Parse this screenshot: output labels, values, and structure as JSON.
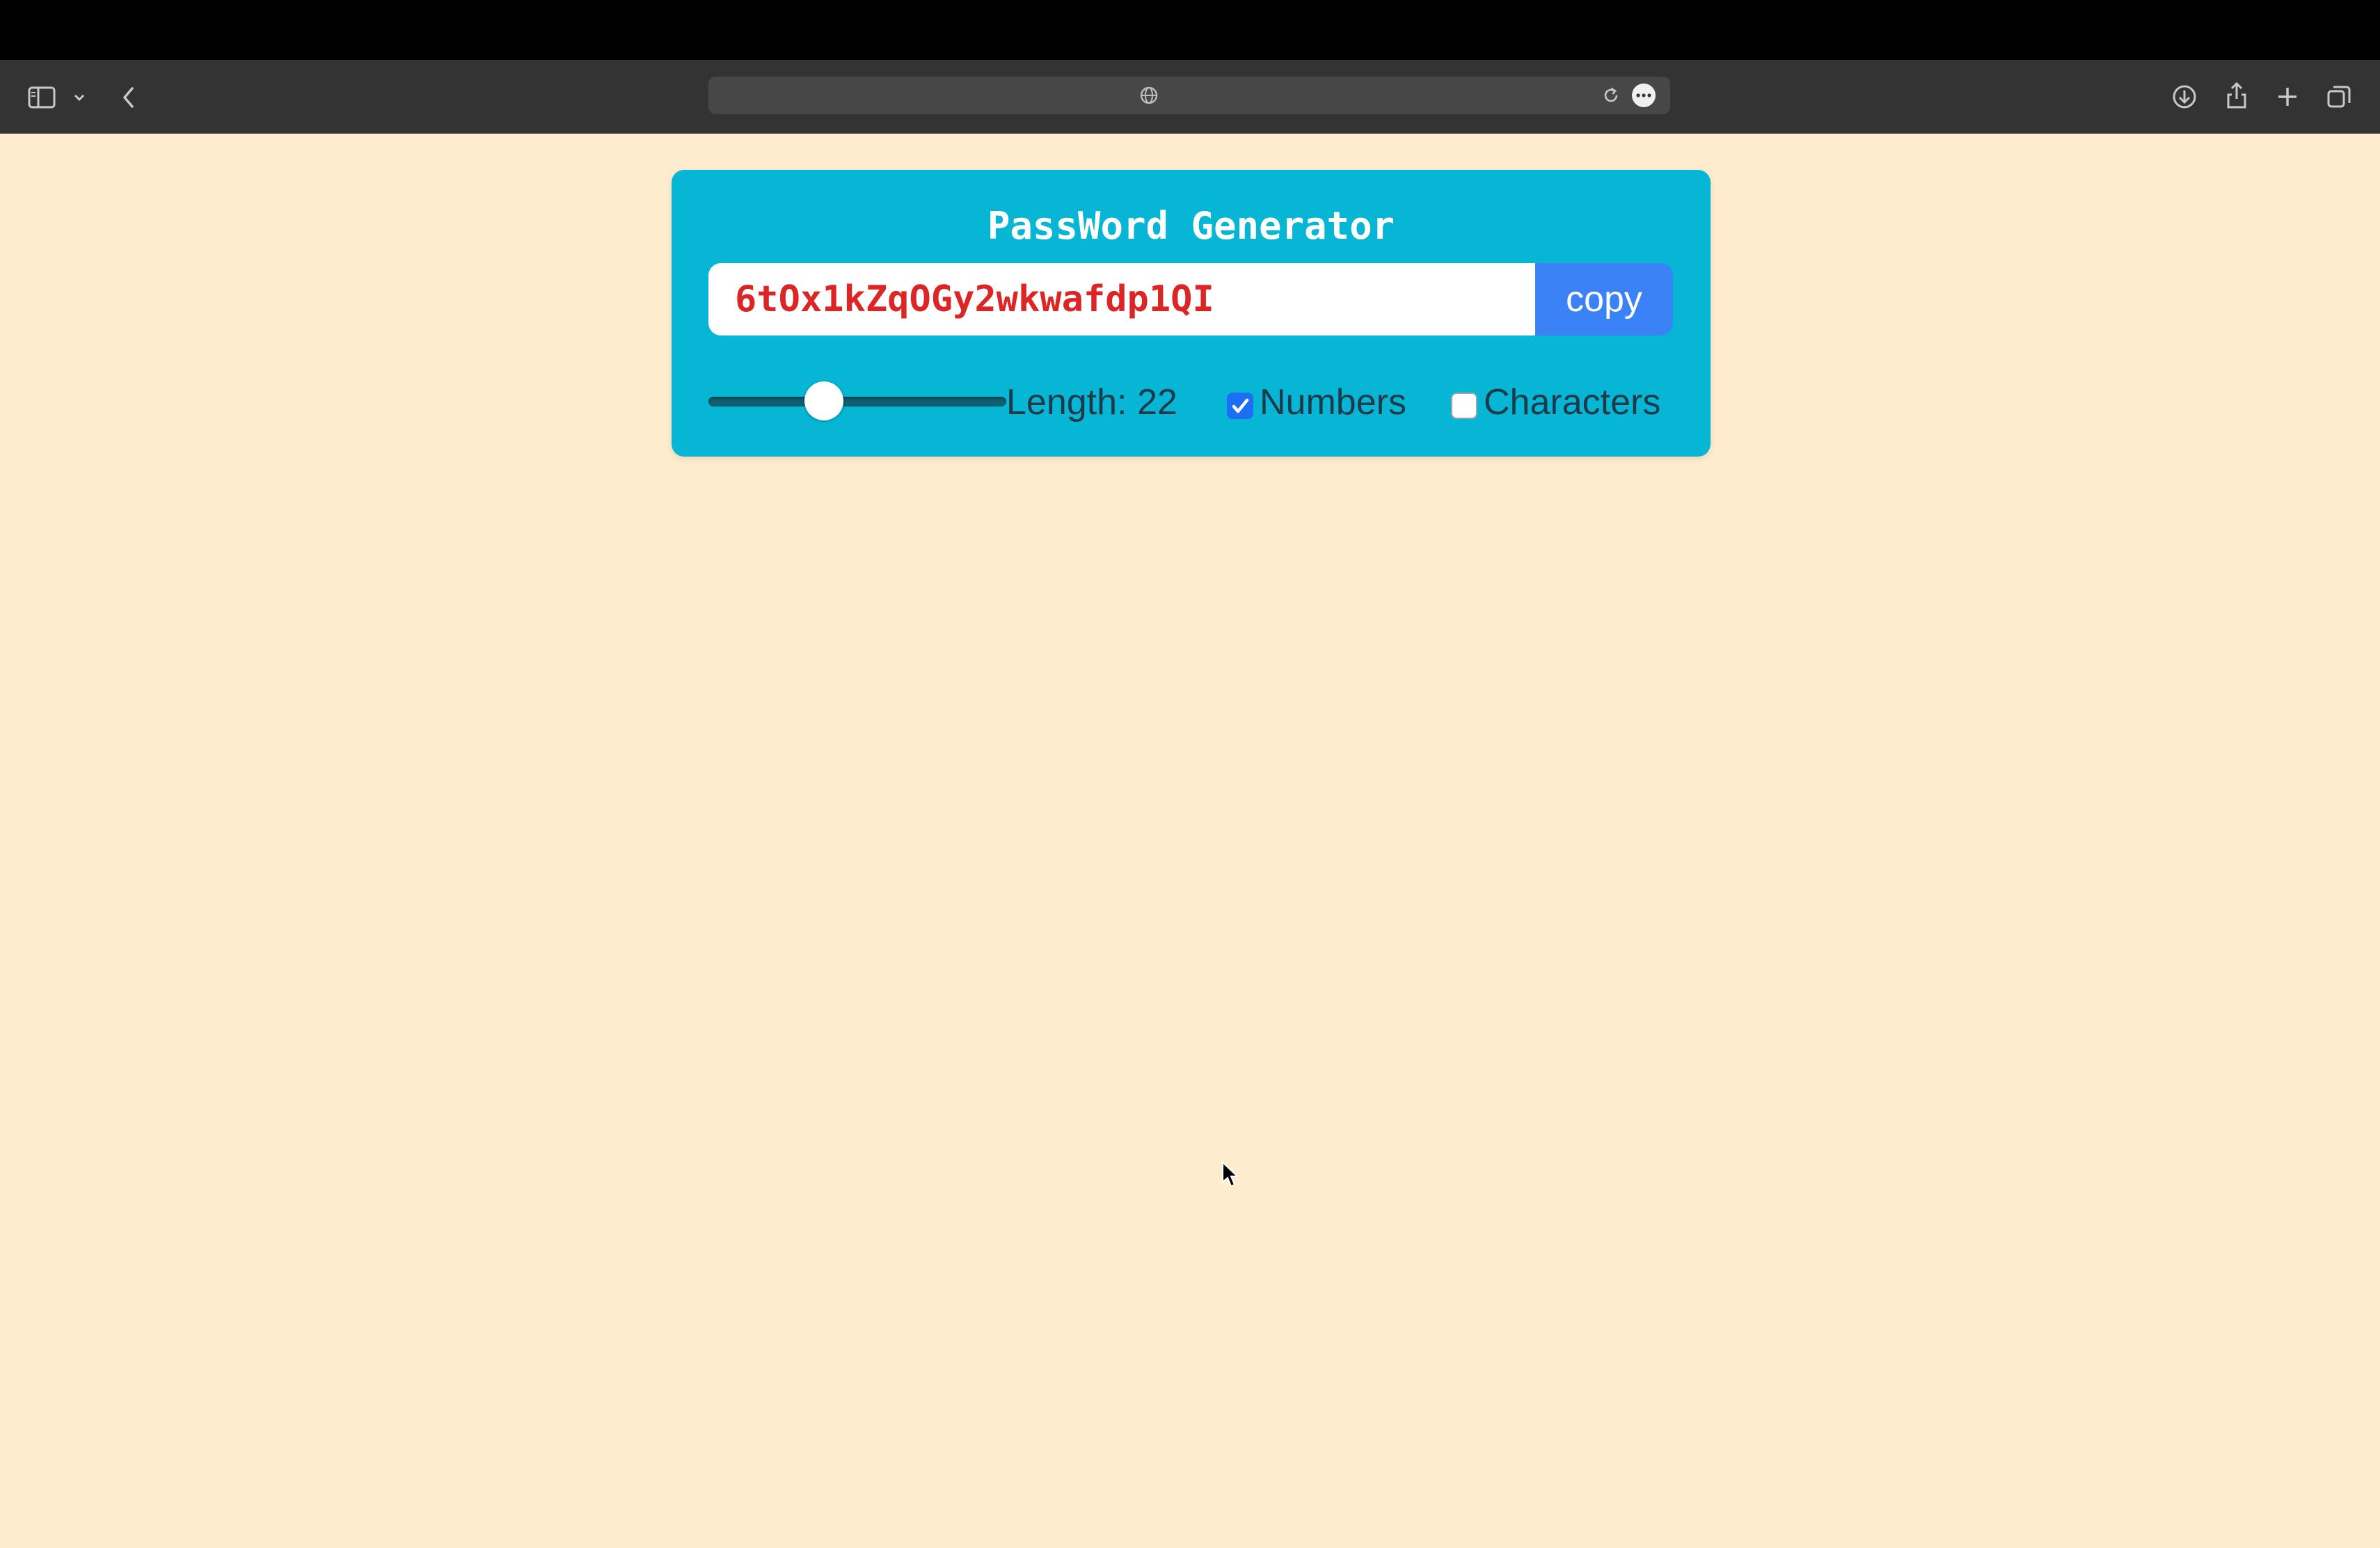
{
  "browser": {
    "icons": [
      "sidebar-icon",
      "chevron-down-icon",
      "back-icon",
      "globe-icon",
      "reload-icon",
      "more-icon",
      "download-icon",
      "share-icon",
      "new-tab-icon",
      "tabs-overview-icon"
    ]
  },
  "app": {
    "title": "PassWord Generator",
    "password": "6tOx1kZqOGy2wkwafdp1QI",
    "copy_label": "copy",
    "length_label": "Length: 22",
    "length_value": 22,
    "length_fraction": 0.39,
    "numbers_label": "Numbers",
    "numbers_checked": true,
    "characters_label": "Characters",
    "characters_checked": false
  },
  "colors": {
    "page_bg": "#ffebcd",
    "card_bg": "#06b6d4",
    "password_text": "#dc2626",
    "copy_button": "#3b82f6",
    "checkbox_checked": "#1d6ef5"
  }
}
